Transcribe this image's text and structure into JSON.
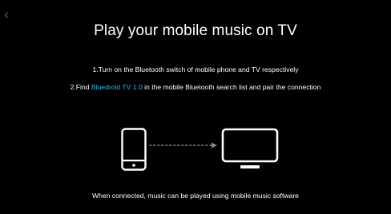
{
  "title": "Play your mobile music on TV",
  "instructions": {
    "step1": "1.Turn on the Bluetooth switch of mobile phone and TV respectively",
    "step2": {
      "prefix": "2.Find ",
      "device_name": "Bluedroid TV 1.0",
      "suffix": " in the mobile Bluetooth search list and pair the connection"
    }
  },
  "illustration": {
    "source_icon": "smartphone-icon",
    "connector_icon": "dotted-arrow-icon",
    "target_icon": "tv-icon"
  },
  "footer": "When connected, music can be played using mobile music software",
  "colors": {
    "background": "#000000",
    "text": "#ffffff",
    "highlight": "#29b6e8",
    "connector": "#8a8a8a"
  }
}
